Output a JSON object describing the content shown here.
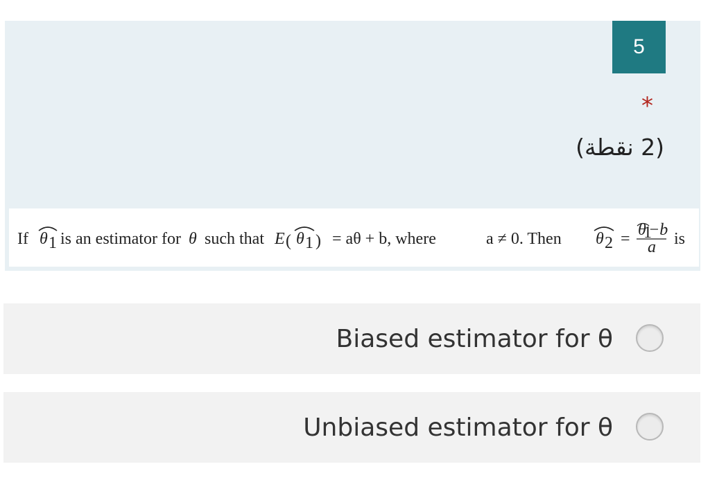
{
  "question": {
    "number": "5",
    "required_marker": "*",
    "points": "(2 نقطة)",
    "statement": {
      "if": "If",
      "theta1": "θ",
      "sub1": "1",
      "is_an": "is an estimator for",
      "theta": "θ",
      "such_that": "such that",
      "E": "E",
      "lparen": "(",
      "rparen": ")",
      "equals_rhs": "= aθ + b, where",
      "a_neq": "a ≠ 0. Then",
      "theta2": "θ",
      "sub2": "2",
      "eq": "=",
      "frac_num_tail": "−b",
      "frac_den": "a",
      "is": "is"
    }
  },
  "options": [
    {
      "label": "Biased estimator for θ",
      "selected": false
    },
    {
      "label": "Unbiased estimator for θ",
      "selected": false
    }
  ]
}
